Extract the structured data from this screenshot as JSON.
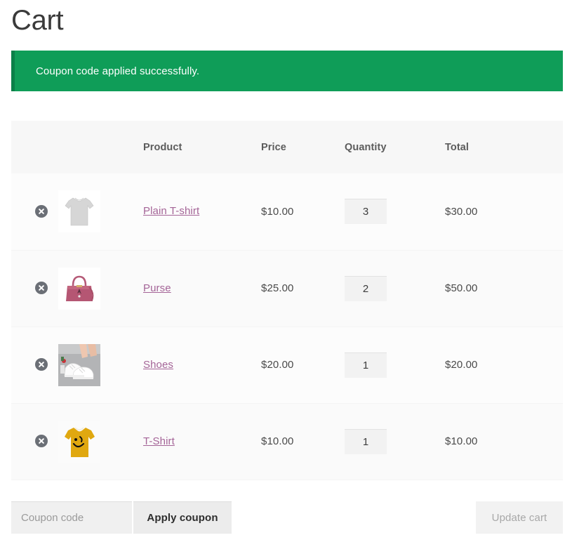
{
  "page": {
    "title": "Cart"
  },
  "notice": {
    "message": "Coupon code applied successfully.",
    "background_color": "#0f9d58",
    "accent_color": "#0a8049",
    "text_color": "#ffffff"
  },
  "table": {
    "headers": {
      "remove": "",
      "thumbnail": "",
      "product": "Product",
      "price": "Price",
      "quantity": "Quantity",
      "total": "Total"
    },
    "rows": [
      {
        "remove_label": "Remove this item",
        "thumbnail": "plain-tshirt-thumbnail",
        "name": "Plain T-shirt",
        "price": "$10.00",
        "quantity": "3",
        "total": "$30.00"
      },
      {
        "remove_label": "Remove this item",
        "thumbnail": "purse-thumbnail",
        "name": "Purse",
        "price": "$25.00",
        "quantity": "2",
        "total": "$50.00"
      },
      {
        "remove_label": "Remove this item",
        "thumbnail": "shoes-thumbnail",
        "name": "Shoes",
        "price": "$20.00",
        "quantity": "1",
        "total": "$20.00"
      },
      {
        "remove_label": "Remove this item",
        "thumbnail": "tshirt-smiley-thumbnail",
        "name": "T-Shirt",
        "price": "$10.00",
        "quantity": "1",
        "total": "$10.00"
      }
    ]
  },
  "actions": {
    "coupon_placeholder": "Coupon code",
    "coupon_value": "",
    "apply_label": "Apply coupon",
    "update_label": "Update cart",
    "update_disabled": true
  },
  "colors": {
    "link": "#a46497",
    "header_background": "#f7f7f7",
    "row_background": "#fcfcfc",
    "remove_icon": "#6b6f76"
  }
}
